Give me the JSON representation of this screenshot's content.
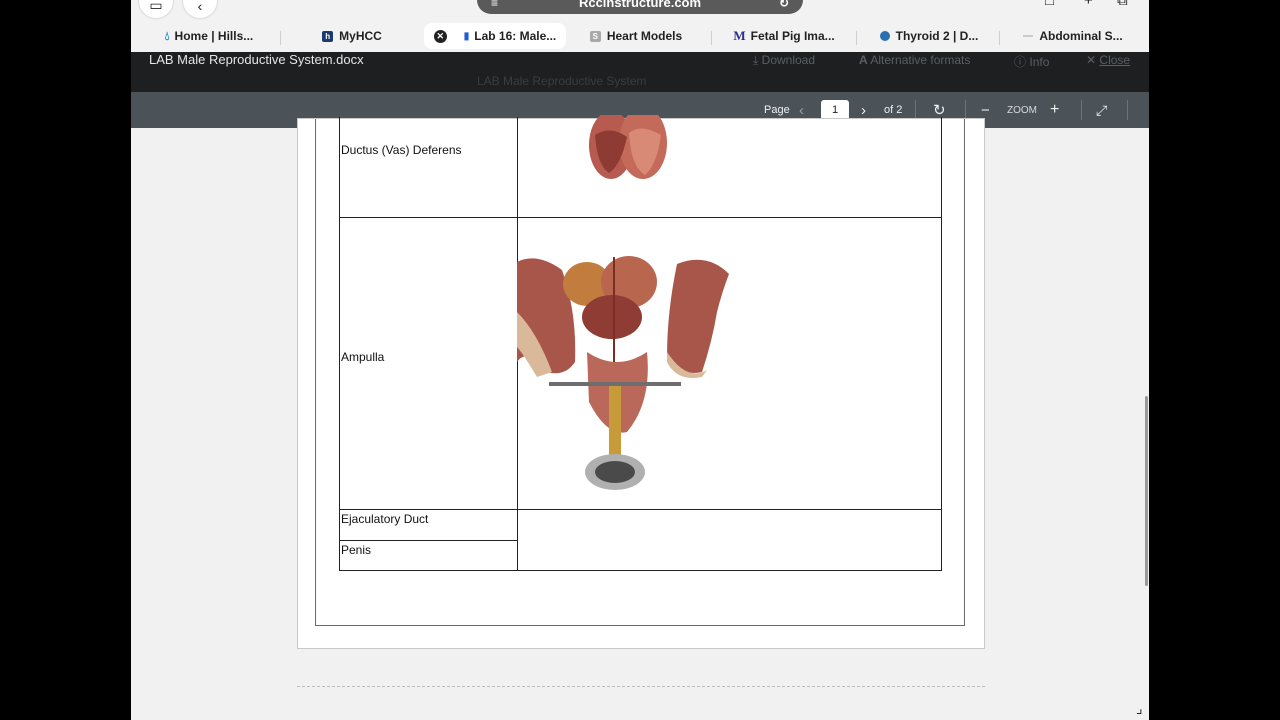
{
  "browser": {
    "url": "Rccinstructure.com",
    "tabs": [
      {
        "label": "Home | Hills...",
        "icon": "drop-icon",
        "color": "#1e88c7",
        "active": false
      },
      {
        "label": "MyHCC",
        "icon": "hcc-icon",
        "color": "#1d3a6e",
        "active": false
      },
      {
        "label": "Lab 16: Male...",
        "icon": "document-icon",
        "color": "#1e5bd8",
        "active": true
      },
      {
        "label": "Heart Models",
        "icon": "s-icon",
        "color": "#9a9a9a",
        "active": false
      },
      {
        "label": "Fetal Pig Ima...",
        "icon": "m-icon",
        "color": "#2a2f8a",
        "active": false
      },
      {
        "label": "Thyroid 2 | D...",
        "icon": "globe-icon",
        "color": "#2b6fb3",
        "active": false
      },
      {
        "label": "Abdominal S...",
        "icon": "blank-page-icon",
        "color": "#cccccc",
        "active": false
      }
    ]
  },
  "doc_header": {
    "title": "LAB Male Reproductive System.docx",
    "subtitle": "LAB Male Reproductive System",
    "download": "Download",
    "alt_formats": "Alternative formats",
    "info": "Info",
    "close": "Close"
  },
  "toolbar": {
    "page_label": "Page",
    "page_value": "1",
    "of_label": "of 2",
    "zoom_label": "ZOOM"
  },
  "table": {
    "rows": [
      {
        "label": "Ductus (Vas) Deferens"
      },
      {
        "label": "Ampulla"
      },
      {
        "label": "Ejaculatory Duct"
      },
      {
        "label": "Penis"
      }
    ]
  },
  "colors": {
    "doc_header_bg": "#1d1f20",
    "toolbar_bg": "#4b5359",
    "model_tissue": "#a8564a"
  }
}
